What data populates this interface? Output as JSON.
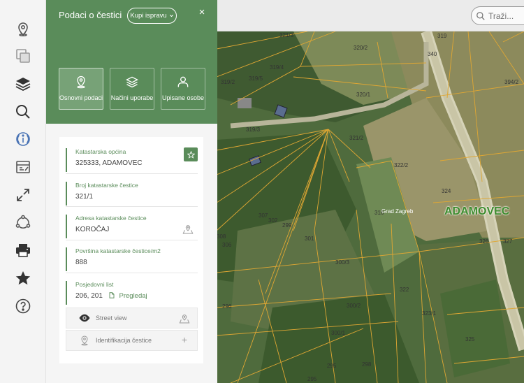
{
  "panel": {
    "title": "Podaci o čestici",
    "buy_label": "Kupi ispravu",
    "close_label": "×",
    "tabs": [
      {
        "label": "Osnovni podaci"
      },
      {
        "label": "Načini uporabe"
      },
      {
        "label": "Upisane osobe"
      }
    ],
    "fields": {
      "municipality": {
        "label": "Katastarska općina",
        "value": "325333, ADAMOVEC"
      },
      "parcel": {
        "label": "Broj katastarske čestice",
        "value": "321/1"
      },
      "address": {
        "label": "Adresa katastarske čestice",
        "value": "KOROČAJ"
      },
      "area": {
        "label": "Površina katastarske čestice/m2",
        "value": "888"
      },
      "possession": {
        "label": "Posjedovni list",
        "value": "206, 201",
        "link": "Pregledaj"
      }
    },
    "actions": {
      "street_view": "Street view",
      "identify": "Identifikacija čestice"
    }
  },
  "search": {
    "placeholder": "Traži..."
  },
  "map": {
    "place_label": "ADAMOVEC",
    "city_label": "Grad Zagreb",
    "parcel_labels": [
      {
        "text": "321/3"
      },
      {
        "text": "319"
      },
      {
        "text": "320/2"
      },
      {
        "text": "319/4"
      },
      {
        "text": "319/2"
      },
      {
        "text": "319/5"
      },
      {
        "text": "320/1"
      },
      {
        "text": "319/3"
      },
      {
        "text": "321/2"
      },
      {
        "text": "322/2"
      },
      {
        "text": "324"
      },
      {
        "text": "307"
      },
      {
        "text": "302"
      },
      {
        "text": "299"
      },
      {
        "text": "300/3"
      },
      {
        "text": "308"
      },
      {
        "text": "306"
      },
      {
        "text": "301"
      },
      {
        "text": "322"
      },
      {
        "text": "300/2"
      },
      {
        "text": "323/1"
      },
      {
        "text": "300/1"
      },
      {
        "text": "325"
      },
      {
        "text": "296"
      },
      {
        "text": "295"
      },
      {
        "text": "298"
      },
      {
        "text": "327"
      },
      {
        "text": "326"
      },
      {
        "text": "316"
      },
      {
        "text": "394/2"
      },
      {
        "text": "340"
      },
      {
        "text": "295"
      }
    ]
  },
  "colors": {
    "accent": "#5a8c5a",
    "panel_bg": "#f5f5f5"
  },
  "toolbar": {
    "icons": [
      "location-pin-icon",
      "stacked-cards-icon",
      "layers-icon",
      "search-icon",
      "info-icon",
      "measure-icon",
      "expand-icon",
      "share-icon",
      "print-icon",
      "star-icon",
      "help-icon"
    ]
  }
}
